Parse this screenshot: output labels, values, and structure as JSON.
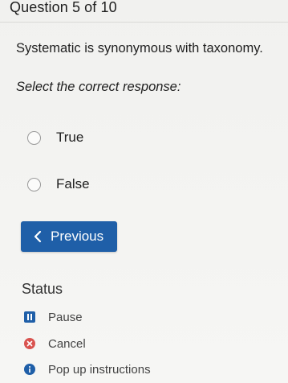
{
  "header": {
    "question_counter": "Question 5 of 10"
  },
  "question": {
    "text": "Systematic is synonymous with taxonomy.",
    "instruction": "Select the correct response:"
  },
  "options": [
    {
      "label": "True",
      "selected": false
    },
    {
      "label": "False",
      "selected": false
    }
  ],
  "navigation": {
    "previous_label": "Previous"
  },
  "status": {
    "title": "Status",
    "items": [
      {
        "label": "Pause",
        "icon": "pause-icon"
      },
      {
        "label": "Cancel",
        "icon": "cancel-icon"
      },
      {
        "label": "Pop up instructions",
        "icon": "info-icon"
      }
    ]
  },
  "colors": {
    "primary_button": "#1f5fa8",
    "cancel": "#d9534f",
    "background": "#f3f3f1"
  }
}
